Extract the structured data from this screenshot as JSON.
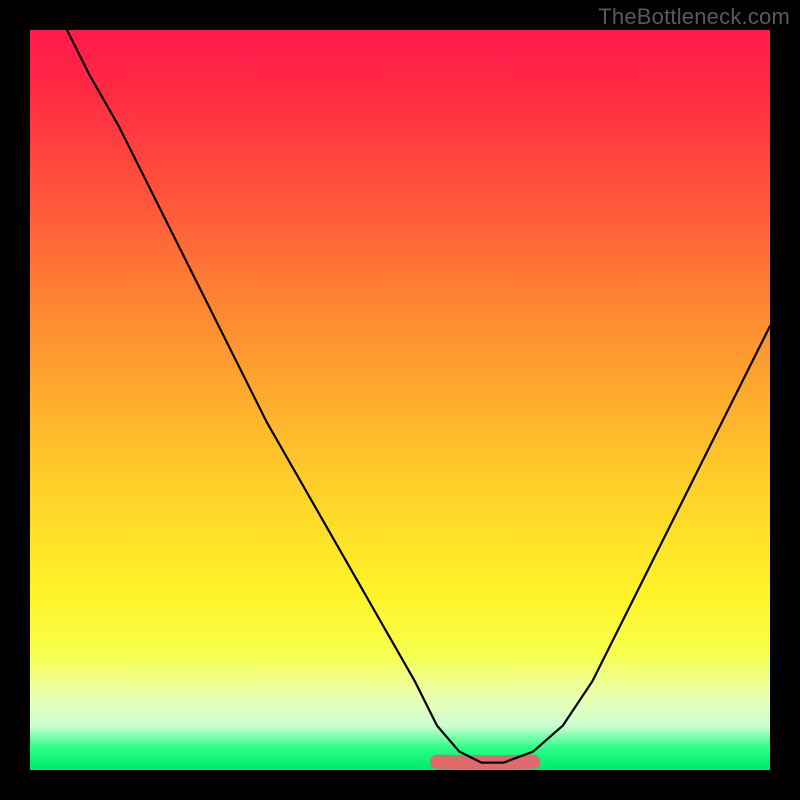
{
  "watermark": "TheBottleneck.com",
  "colors": {
    "curve": "#000000",
    "flat_highlight": "#e06a6a",
    "frame": "#000000",
    "gradient_top": "#ff1a4b",
    "gradient_bottom": "#00e86a",
    "watermark": "#5a5a5a"
  },
  "chart_data": {
    "type": "line",
    "title": "",
    "xlabel": "",
    "ylabel": "",
    "xlim": [
      0,
      100
    ],
    "ylim": [
      0,
      100
    ],
    "grid": false,
    "legend": false,
    "series": [
      {
        "name": "bottleneck-curve",
        "x": [
          5,
          8,
          12,
          16,
          20,
          24,
          28,
          32,
          36,
          40,
          44,
          48,
          52,
          55,
          58,
          61,
          64,
          68,
          72,
          76,
          80,
          84,
          88,
          92,
          96,
          100
        ],
        "y": [
          100,
          94,
          87,
          79,
          71,
          63,
          55,
          47,
          40,
          33,
          26,
          19,
          12,
          6,
          2.5,
          1,
          1,
          2.5,
          6,
          12,
          20,
          28,
          36,
          44,
          52,
          60
        ]
      }
    ],
    "annotations": [
      {
        "name": "flat-bottom-highlight",
        "x_range": [
          55,
          68
        ],
        "y": 1,
        "color": "#e06a6a",
        "thickness": 14
      }
    ]
  }
}
